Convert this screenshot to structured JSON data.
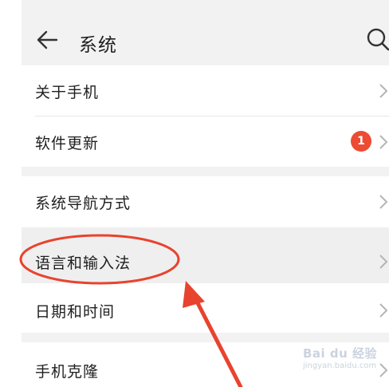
{
  "header": {
    "title": "系统",
    "back_icon": "arrow-left-icon",
    "search_icon": "search-icon"
  },
  "groups": [
    [
      {
        "label": "关于手机"
      },
      {
        "label": "软件更新",
        "badge": "1"
      }
    ],
    [
      {
        "label": "系统导航方式"
      },
      {
        "label": "语言和输入法"
      },
      {
        "label": "日期和时间"
      }
    ],
    [
      {
        "label": "手机克隆"
      }
    ]
  ],
  "colors": {
    "badge": "#ec4b34",
    "annotation": "#e8432e",
    "page_bg": "#f2f2f2",
    "card_bg": "#ffffff"
  },
  "watermark": {
    "text": "Bai du 经验",
    "sub": "jingyan.baidu.com"
  }
}
